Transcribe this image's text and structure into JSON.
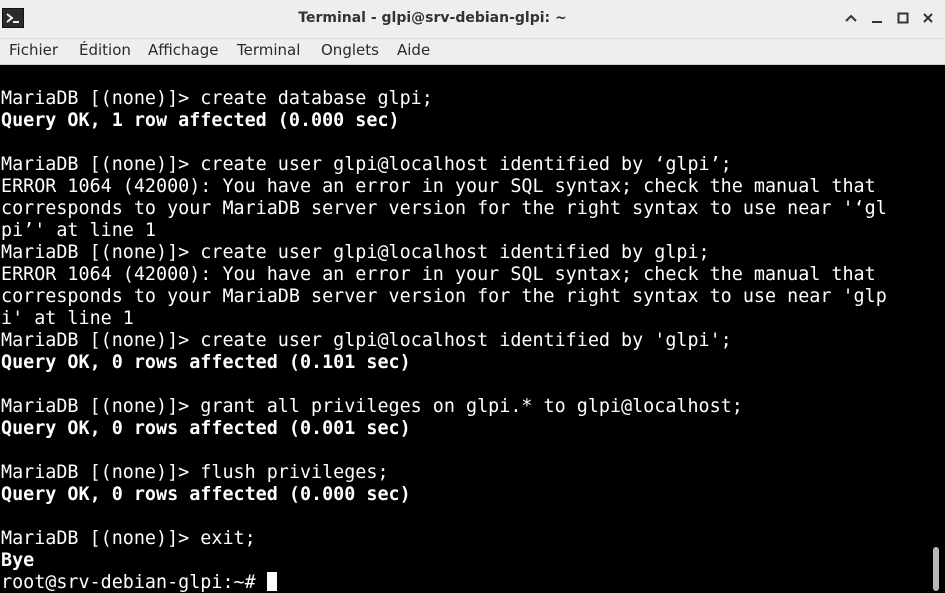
{
  "window": {
    "title": "Terminal - glpi@srv-debian-glpi: ~",
    "icon": "terminal-icon",
    "controls": [
      "chevron-up-icon",
      "minimize-icon",
      "maximize-icon",
      "close-icon"
    ]
  },
  "menu": {
    "items": [
      "Fichier",
      "Édition",
      "Affichage",
      "Terminal",
      "Onglets",
      "Aide"
    ]
  },
  "terminal": {
    "lines": [
      {
        "text": "MariaDB [(none)]> create database glpi;",
        "bold": false
      },
      {
        "text": "Query OK, 1 row affected (0.000 sec)",
        "bold": true
      },
      {
        "text": "",
        "bold": false
      },
      {
        "text": "MariaDB [(none)]> create user glpi@localhost identified by ‘glpi’;",
        "bold": false
      },
      {
        "text": "ERROR 1064 (42000): You have an error in your SQL syntax; check the manual that",
        "bold": false
      },
      {
        "text": "corresponds to your MariaDB server version for the right syntax to use near '‘gl",
        "bold": false
      },
      {
        "text": "pi’' at line 1",
        "bold": false
      },
      {
        "text": "MariaDB [(none)]> create user glpi@localhost identified by glpi;",
        "bold": false
      },
      {
        "text": "ERROR 1064 (42000): You have an error in your SQL syntax; check the manual that",
        "bold": false
      },
      {
        "text": "corresponds to your MariaDB server version for the right syntax to use near 'glp",
        "bold": false
      },
      {
        "text": "i' at line 1",
        "bold": false
      },
      {
        "text": "MariaDB [(none)]> create user glpi@localhost identified by 'glpi';",
        "bold": false
      },
      {
        "text": "Query OK, 0 rows affected (0.101 sec)",
        "bold": true
      },
      {
        "text": "",
        "bold": false
      },
      {
        "text": "MariaDB [(none)]> grant all privileges on glpi.* to glpi@localhost;",
        "bold": false
      },
      {
        "text": "Query OK, 0 rows affected (0.001 sec)",
        "bold": true
      },
      {
        "text": "",
        "bold": false
      },
      {
        "text": "MariaDB [(none)]> flush privileges;",
        "bold": false
      },
      {
        "text": "Query OK, 0 rows affected (0.000 sec)",
        "bold": true
      },
      {
        "text": "",
        "bold": false
      },
      {
        "text": "MariaDB [(none)]> exit;",
        "bold": false
      },
      {
        "text": "Bye",
        "bold": true
      }
    ],
    "prompt": "root@srv-debian-glpi:~# "
  },
  "colors": {
    "background": "#000000",
    "foreground": "#ffffff",
    "chrome": "#eeeeee"
  }
}
